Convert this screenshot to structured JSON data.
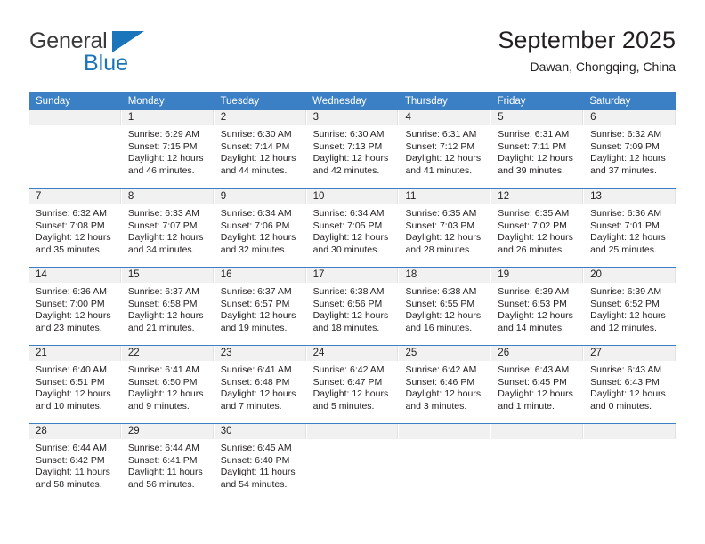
{
  "brand": {
    "name_part1": "General",
    "name_part2": "Blue",
    "triangle_color": "#1b75bb",
    "blue_text_color": "#1b75bb"
  },
  "header": {
    "month_title": "September 2025",
    "location": "Dawan, Chongqing, China"
  },
  "theme": {
    "header_blue": "#3b7fc4",
    "daynum_band": "#f1f1f1",
    "text": "#231f20"
  },
  "calendar": {
    "day_headers": [
      "Sunday",
      "Monday",
      "Tuesday",
      "Wednesday",
      "Thursday",
      "Friday",
      "Saturday"
    ],
    "weeks": [
      [
        {
          "day": "",
          "sunrise": "",
          "sunset": "",
          "daylight_line1": "",
          "daylight_line2": ""
        },
        {
          "day": "1",
          "sunrise": "Sunrise: 6:29 AM",
          "sunset": "Sunset: 7:15 PM",
          "daylight_line1": "Daylight: 12 hours",
          "daylight_line2": "and 46 minutes."
        },
        {
          "day": "2",
          "sunrise": "Sunrise: 6:30 AM",
          "sunset": "Sunset: 7:14 PM",
          "daylight_line1": "Daylight: 12 hours",
          "daylight_line2": "and 44 minutes."
        },
        {
          "day": "3",
          "sunrise": "Sunrise: 6:30 AM",
          "sunset": "Sunset: 7:13 PM",
          "daylight_line1": "Daylight: 12 hours",
          "daylight_line2": "and 42 minutes."
        },
        {
          "day": "4",
          "sunrise": "Sunrise: 6:31 AM",
          "sunset": "Sunset: 7:12 PM",
          "daylight_line1": "Daylight: 12 hours",
          "daylight_line2": "and 41 minutes."
        },
        {
          "day": "5",
          "sunrise": "Sunrise: 6:31 AM",
          "sunset": "Sunset: 7:11 PM",
          "daylight_line1": "Daylight: 12 hours",
          "daylight_line2": "and 39 minutes."
        },
        {
          "day": "6",
          "sunrise": "Sunrise: 6:32 AM",
          "sunset": "Sunset: 7:09 PM",
          "daylight_line1": "Daylight: 12 hours",
          "daylight_line2": "and 37 minutes."
        }
      ],
      [
        {
          "day": "7",
          "sunrise": "Sunrise: 6:32 AM",
          "sunset": "Sunset: 7:08 PM",
          "daylight_line1": "Daylight: 12 hours",
          "daylight_line2": "and 35 minutes."
        },
        {
          "day": "8",
          "sunrise": "Sunrise: 6:33 AM",
          "sunset": "Sunset: 7:07 PM",
          "daylight_line1": "Daylight: 12 hours",
          "daylight_line2": "and 34 minutes."
        },
        {
          "day": "9",
          "sunrise": "Sunrise: 6:34 AM",
          "sunset": "Sunset: 7:06 PM",
          "daylight_line1": "Daylight: 12 hours",
          "daylight_line2": "and 32 minutes."
        },
        {
          "day": "10",
          "sunrise": "Sunrise: 6:34 AM",
          "sunset": "Sunset: 7:05 PM",
          "daylight_line1": "Daylight: 12 hours",
          "daylight_line2": "and 30 minutes."
        },
        {
          "day": "11",
          "sunrise": "Sunrise: 6:35 AM",
          "sunset": "Sunset: 7:03 PM",
          "daylight_line1": "Daylight: 12 hours",
          "daylight_line2": "and 28 minutes."
        },
        {
          "day": "12",
          "sunrise": "Sunrise: 6:35 AM",
          "sunset": "Sunset: 7:02 PM",
          "daylight_line1": "Daylight: 12 hours",
          "daylight_line2": "and 26 minutes."
        },
        {
          "day": "13",
          "sunrise": "Sunrise: 6:36 AM",
          "sunset": "Sunset: 7:01 PM",
          "daylight_line1": "Daylight: 12 hours",
          "daylight_line2": "and 25 minutes."
        }
      ],
      [
        {
          "day": "14",
          "sunrise": "Sunrise: 6:36 AM",
          "sunset": "Sunset: 7:00 PM",
          "daylight_line1": "Daylight: 12 hours",
          "daylight_line2": "and 23 minutes."
        },
        {
          "day": "15",
          "sunrise": "Sunrise: 6:37 AM",
          "sunset": "Sunset: 6:58 PM",
          "daylight_line1": "Daylight: 12 hours",
          "daylight_line2": "and 21 minutes."
        },
        {
          "day": "16",
          "sunrise": "Sunrise: 6:37 AM",
          "sunset": "Sunset: 6:57 PM",
          "daylight_line1": "Daylight: 12 hours",
          "daylight_line2": "and 19 minutes."
        },
        {
          "day": "17",
          "sunrise": "Sunrise: 6:38 AM",
          "sunset": "Sunset: 6:56 PM",
          "daylight_line1": "Daylight: 12 hours",
          "daylight_line2": "and 18 minutes."
        },
        {
          "day": "18",
          "sunrise": "Sunrise: 6:38 AM",
          "sunset": "Sunset: 6:55 PM",
          "daylight_line1": "Daylight: 12 hours",
          "daylight_line2": "and 16 minutes."
        },
        {
          "day": "19",
          "sunrise": "Sunrise: 6:39 AM",
          "sunset": "Sunset: 6:53 PM",
          "daylight_line1": "Daylight: 12 hours",
          "daylight_line2": "and 14 minutes."
        },
        {
          "day": "20",
          "sunrise": "Sunrise: 6:39 AM",
          "sunset": "Sunset: 6:52 PM",
          "daylight_line1": "Daylight: 12 hours",
          "daylight_line2": "and 12 minutes."
        }
      ],
      [
        {
          "day": "21",
          "sunrise": "Sunrise: 6:40 AM",
          "sunset": "Sunset: 6:51 PM",
          "daylight_line1": "Daylight: 12 hours",
          "daylight_line2": "and 10 minutes."
        },
        {
          "day": "22",
          "sunrise": "Sunrise: 6:41 AM",
          "sunset": "Sunset: 6:50 PM",
          "daylight_line1": "Daylight: 12 hours",
          "daylight_line2": "and 9 minutes."
        },
        {
          "day": "23",
          "sunrise": "Sunrise: 6:41 AM",
          "sunset": "Sunset: 6:48 PM",
          "daylight_line1": "Daylight: 12 hours",
          "daylight_line2": "and 7 minutes."
        },
        {
          "day": "24",
          "sunrise": "Sunrise: 6:42 AM",
          "sunset": "Sunset: 6:47 PM",
          "daylight_line1": "Daylight: 12 hours",
          "daylight_line2": "and 5 minutes."
        },
        {
          "day": "25",
          "sunrise": "Sunrise: 6:42 AM",
          "sunset": "Sunset: 6:46 PM",
          "daylight_line1": "Daylight: 12 hours",
          "daylight_line2": "and 3 minutes."
        },
        {
          "day": "26",
          "sunrise": "Sunrise: 6:43 AM",
          "sunset": "Sunset: 6:45 PM",
          "daylight_line1": "Daylight: 12 hours",
          "daylight_line2": "and 1 minute."
        },
        {
          "day": "27",
          "sunrise": "Sunrise: 6:43 AM",
          "sunset": "Sunset: 6:43 PM",
          "daylight_line1": "Daylight: 12 hours",
          "daylight_line2": "and 0 minutes."
        }
      ],
      [
        {
          "day": "28",
          "sunrise": "Sunrise: 6:44 AM",
          "sunset": "Sunset: 6:42 PM",
          "daylight_line1": "Daylight: 11 hours",
          "daylight_line2": "and 58 minutes."
        },
        {
          "day": "29",
          "sunrise": "Sunrise: 6:44 AM",
          "sunset": "Sunset: 6:41 PM",
          "daylight_line1": "Daylight: 11 hours",
          "daylight_line2": "and 56 minutes."
        },
        {
          "day": "30",
          "sunrise": "Sunrise: 6:45 AM",
          "sunset": "Sunset: 6:40 PM",
          "daylight_line1": "Daylight: 11 hours",
          "daylight_line2": "and 54 minutes."
        },
        {
          "day": "",
          "sunrise": "",
          "sunset": "",
          "daylight_line1": "",
          "daylight_line2": ""
        },
        {
          "day": "",
          "sunrise": "",
          "sunset": "",
          "daylight_line1": "",
          "daylight_line2": ""
        },
        {
          "day": "",
          "sunrise": "",
          "sunset": "",
          "daylight_line1": "",
          "daylight_line2": ""
        },
        {
          "day": "",
          "sunrise": "",
          "sunset": "",
          "daylight_line1": "",
          "daylight_line2": ""
        }
      ]
    ]
  }
}
